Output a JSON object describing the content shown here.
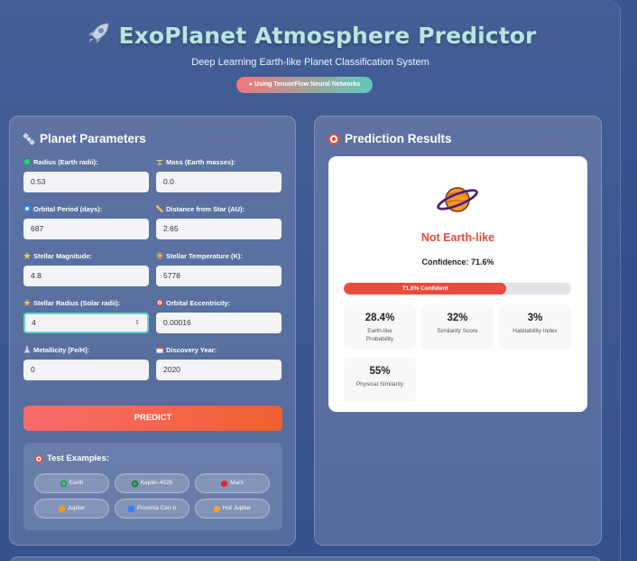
{
  "header": {
    "title": "ExoPlanet Atmosphere Predictor",
    "subtitle": "Deep Learning Earth-like Planet Classification System",
    "badge": "Using TensorFlow Neural Networks"
  },
  "params": {
    "heading": "Planet Parameters",
    "fields": [
      {
        "label": "Radius (Earth radii):",
        "value": "0.53",
        "icon": "globe-icon"
      },
      {
        "label": "Mass (Earth masses):",
        "value": "0.0",
        "icon": "scale-icon"
      },
      {
        "label": "Orbital Period (days):",
        "value": "687",
        "icon": "orbit-icon"
      },
      {
        "label": "Distance from Star (AU):",
        "value": "2.65",
        "icon": "ruler-icon"
      },
      {
        "label": "Stellar Magnitude:",
        "value": "4.8",
        "icon": "star-icon"
      },
      {
        "label": "Stellar Temperature (K):",
        "value": "5778",
        "icon": "sun-icon"
      },
      {
        "label": "Stellar Radius (Solar radii):",
        "value": "4",
        "icon": "star-icon"
      },
      {
        "label": "Orbital Eccentricity:",
        "value": "0.00016",
        "icon": "target-icon"
      },
      {
        "label": "Metallicity [Fe/H]:",
        "value": "0",
        "icon": "flask-icon"
      },
      {
        "label": "Discovery Year:",
        "value": "2020",
        "icon": "calendar-icon"
      }
    ],
    "predict_label": "PREDICT"
  },
  "examples": {
    "heading": "Test Examples:",
    "items": [
      "Earth",
      "Kepler-452b",
      "Mars",
      "Jupiter",
      "Proxima Cen b",
      "Hot Jupiter"
    ]
  },
  "results": {
    "heading": "Prediction Results",
    "label": "Not Earth-like",
    "confidence_text": "Confidence: 71.6%",
    "confidence_bar_text": "71.6% Confident",
    "confidence_value": 71.6,
    "stats": [
      {
        "value": "28.4%",
        "label": "Earth-like Probability"
      },
      {
        "value": "32%",
        "label": "Similarity Score"
      },
      {
        "value": "3%",
        "label": "Habitability Index"
      },
      {
        "value": "55%",
        "label": "Physical Similarity"
      }
    ]
  },
  "colors": {
    "title": "#b8e6df",
    "accent_red": "#e74c3c",
    "predict_start": "#fa6b6b",
    "predict_end": "#f0612f",
    "focus": "#66d6c4"
  }
}
